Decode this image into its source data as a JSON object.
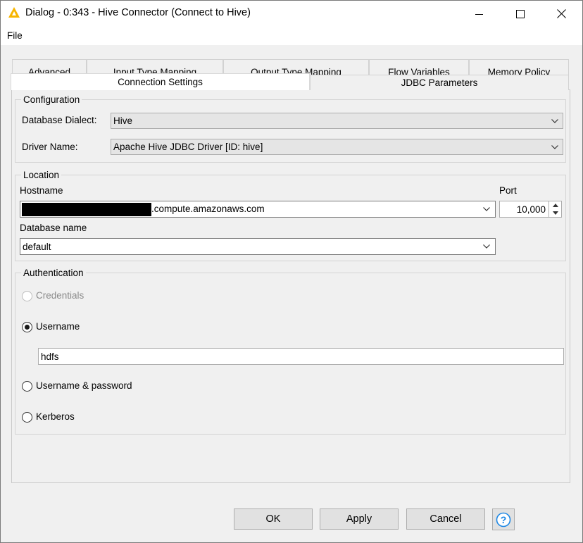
{
  "window": {
    "title": "Dialog - 0:343 - Hive Connector (Connect to Hive)",
    "logo_icon": "knime-triangle-icon",
    "controls": [
      "minimize-icon",
      "maximize-icon",
      "close-icon"
    ]
  },
  "menu": {
    "file": "File"
  },
  "tabs": {
    "row1": [
      "Advanced",
      "Input Type Mapping",
      "Output Type Mapping",
      "Flow Variables",
      "Memory Policy"
    ],
    "row2": [
      "Connection Settings",
      "JDBC Parameters"
    ],
    "active": "Connection Settings"
  },
  "configuration": {
    "legend": "Configuration",
    "dialect_label": "Database Dialect:",
    "dialect_value": "Hive",
    "driver_label": "Driver Name:",
    "driver_value": "Apache Hive JDBC Driver [ID: hive]"
  },
  "location": {
    "legend": "Location",
    "hostname_label": "Hostname",
    "hostname_suffix": ".compute.amazonaws.com",
    "hostname_redacted": true,
    "port_label": "Port",
    "port_value": "10,000",
    "dbname_label": "Database name",
    "dbname_value": "default"
  },
  "authentication": {
    "legend": "Authentication",
    "options": [
      {
        "label": "Credentials",
        "selected": false,
        "enabled": false
      },
      {
        "label": "Username",
        "selected": true,
        "enabled": true
      },
      {
        "label": "Username & password",
        "selected": false,
        "enabled": true
      },
      {
        "label": "Kerberos",
        "selected": false,
        "enabled": true
      }
    ],
    "username_value": "hdfs"
  },
  "buttons": {
    "ok": "OK",
    "apply": "Apply",
    "cancel": "Cancel",
    "help_icon": "help-icon"
  },
  "colors": {
    "accent": "#0078d7",
    "logo": "#f7b500",
    "background": "#f0f0f0"
  }
}
